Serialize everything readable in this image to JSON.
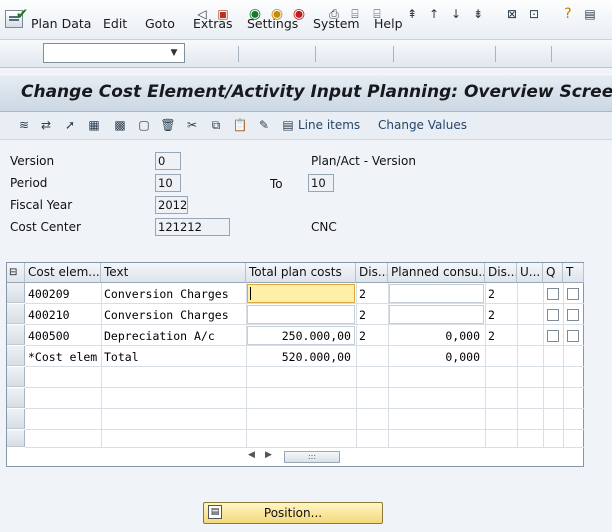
{
  "menu": {
    "items": [
      "Plan Data",
      "Edit",
      "Goto",
      "Extras",
      "Settings",
      "System",
      "Help"
    ]
  },
  "toolbar": {
    "command_value": ""
  },
  "title": "Change Cost Element/Activity Input Planning: Overview Screen",
  "app_toolbar": {
    "line_items": "Line items",
    "change_values": "Change Values"
  },
  "header": {
    "version_label": "Version",
    "version_value": "0",
    "version_text": "Plan/Act - Version",
    "period_label": "Period",
    "period_from": "10",
    "to_label": "To",
    "period_to": "10",
    "fiscal_year_label": "Fiscal Year",
    "fiscal_year": "2012",
    "cost_center_label": "Cost Center",
    "cost_center": "121212",
    "cost_center_text": "CNC"
  },
  "grid": {
    "columns": [
      "Cost elem...",
      "Text",
      "Total plan costs",
      "Dis...",
      "Planned consu...",
      "Dis...",
      "U...",
      "Q",
      "T"
    ],
    "rows": [
      {
        "cost_element": "400209",
        "text": "Conversion Charges",
        "total": "",
        "dis1": "2",
        "planned": "",
        "dis2": "2"
      },
      {
        "cost_element": "400210",
        "text": "Conversion Charges",
        "total": "",
        "dis1": "2",
        "planned": "",
        "dis2": "2"
      },
      {
        "cost_element": "400500",
        "text": "Depreciation A/c",
        "total": "250.000,00",
        "dis1": "2",
        "planned": "0,000",
        "dis2": "2"
      },
      {
        "cost_element": "*Cost elem",
        "text": "Total",
        "total": "520.000,00",
        "dis1": "",
        "planned": "0,000",
        "dis2": ""
      }
    ]
  },
  "footer": {
    "position_label": "Position..."
  },
  "colors": {
    "title_bg": "#cbd7e3",
    "highlight_cell": "#fff0a8",
    "button_bg": "#f3d97c"
  }
}
